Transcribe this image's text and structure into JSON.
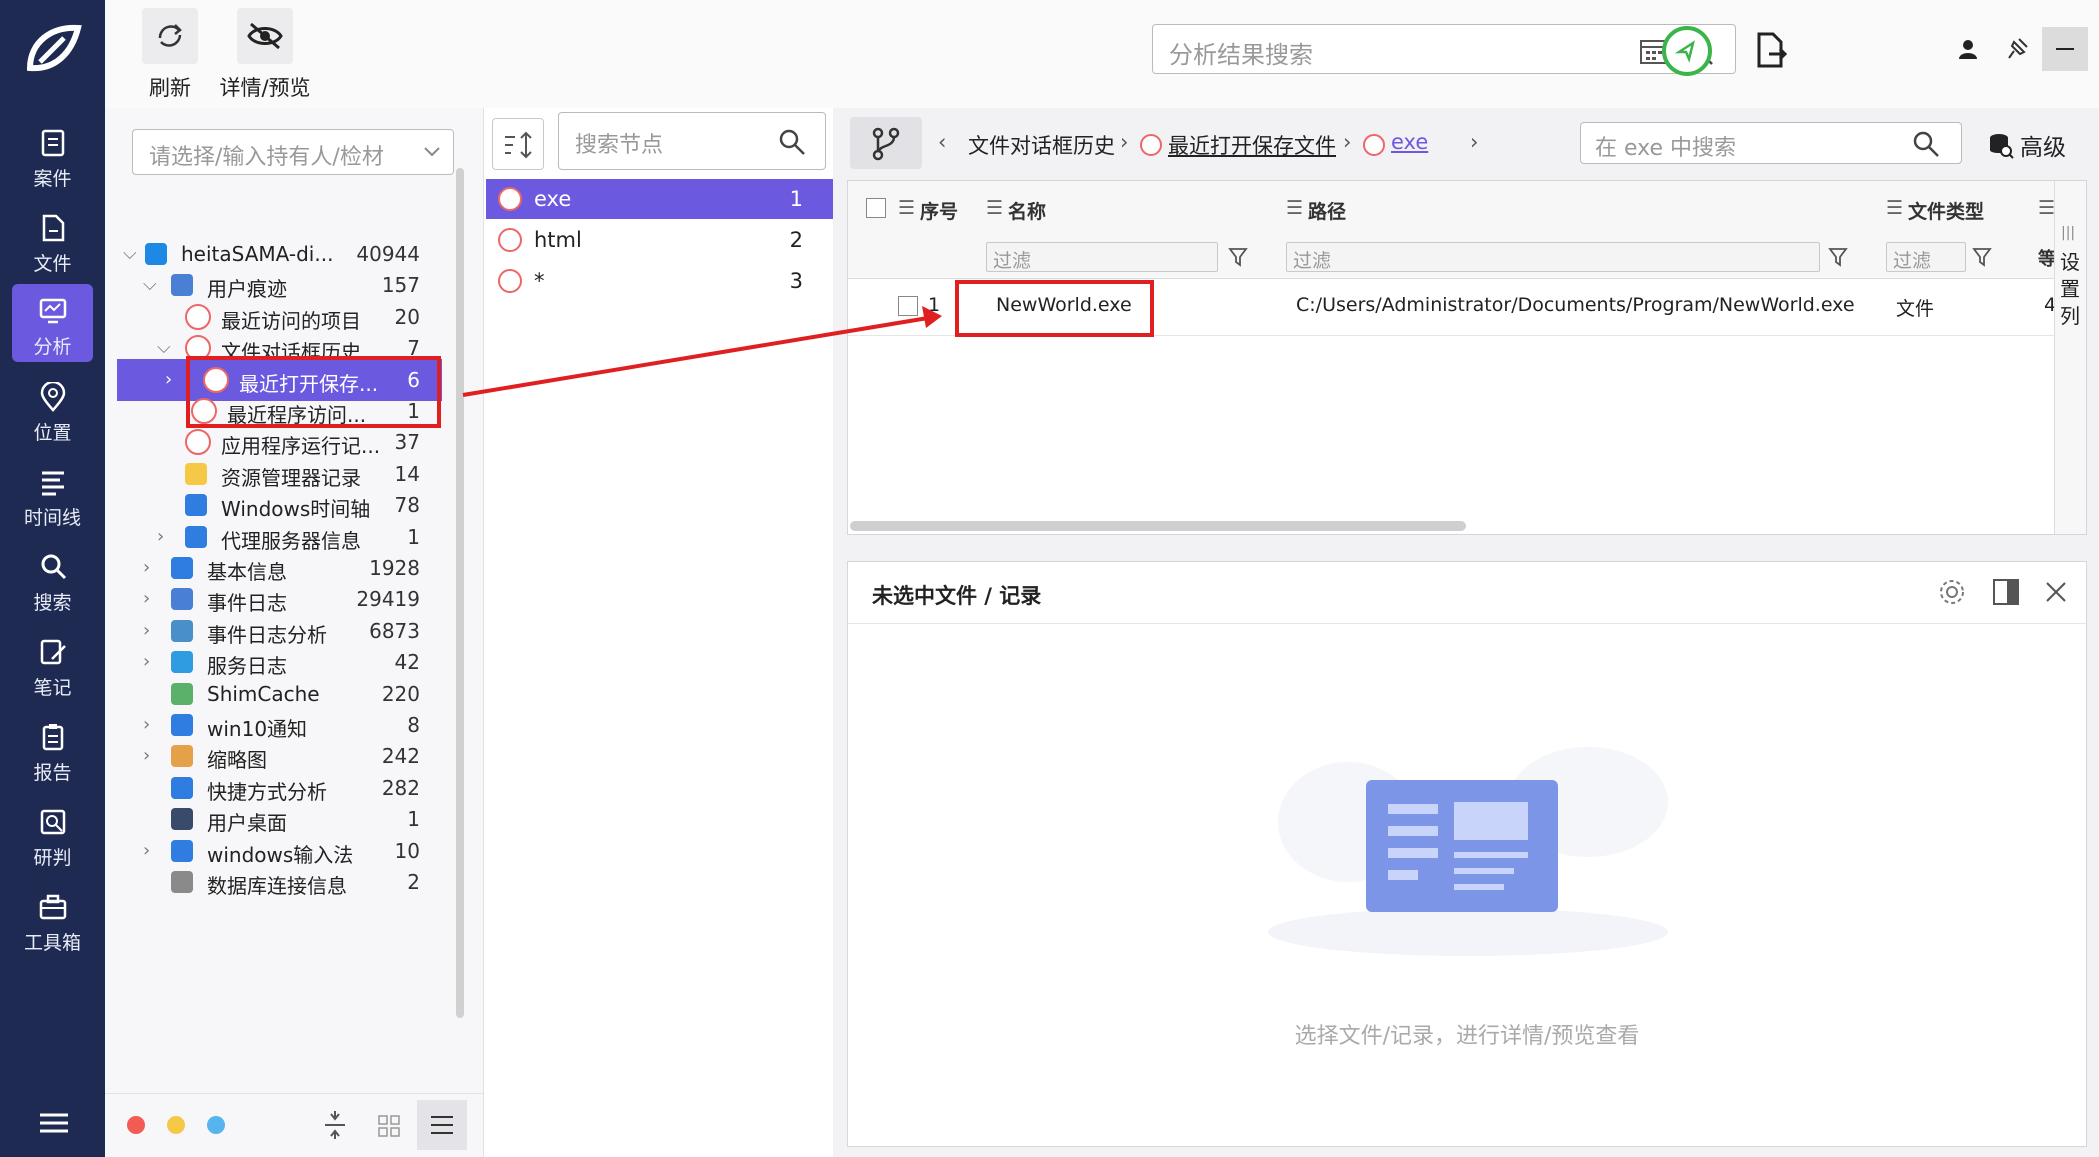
{
  "sidebar": {
    "items": [
      {
        "label": "案件",
        "icon": "case-icon"
      },
      {
        "label": "文件",
        "icon": "file-icon"
      },
      {
        "label": "分析",
        "icon": "analysis-icon"
      },
      {
        "label": "位置",
        "icon": "location-icon"
      },
      {
        "label": "时间线",
        "icon": "timeline-icon"
      },
      {
        "label": "搜索",
        "icon": "search-icon"
      },
      {
        "label": "笔记",
        "icon": "note-icon"
      },
      {
        "label": "报告",
        "icon": "report-icon"
      },
      {
        "label": "研判",
        "icon": "judge-icon"
      },
      {
        "label": "工具箱",
        "icon": "toolbox-icon"
      }
    ],
    "active_index": 2
  },
  "toolbar": {
    "refresh_label": "刷新",
    "preview_label": "详情/预览",
    "search_placeholder": "分析结果搜索"
  },
  "tree": {
    "owner_placeholder": "请选择/输入持有人/检材",
    "items": [
      {
        "label": "heitaSAMA-di...",
        "count": "40944",
        "level": 0,
        "expanded": true,
        "icon": "windows-icon"
      },
      {
        "label": "用户痕迹",
        "count": "157",
        "level": 1,
        "expanded": true,
        "icon": "user-trace-icon"
      },
      {
        "label": "最近访问的项目",
        "count": "20",
        "level": 2,
        "icon": "clock-icon"
      },
      {
        "label": "文件对话框历史",
        "count": "7",
        "level": 2,
        "expanded": true,
        "icon": "clock-icon"
      },
      {
        "label": "最近打开保存...",
        "count": "6",
        "level": 3,
        "selected": true,
        "icon": "clock-icon"
      },
      {
        "label": "最近程序访问...",
        "count": "1",
        "level": 3,
        "icon": "clock-icon"
      },
      {
        "label": "应用程序运行记...",
        "count": "37",
        "level": 2,
        "icon": "clock-icon"
      },
      {
        "label": "资源管理器记录",
        "count": "14",
        "level": 2,
        "icon": "folder-icon"
      },
      {
        "label": "Windows时间轴",
        "count": "78",
        "level": 2,
        "icon": "timeline-icon"
      },
      {
        "label": "代理服务器信息",
        "count": "1",
        "level": 2,
        "collapsed": true,
        "icon": "proxy-icon"
      },
      {
        "label": "基本信息",
        "count": "1928",
        "level": 1,
        "collapsed": true,
        "icon": "list-icon"
      },
      {
        "label": "事件日志",
        "count": "29419",
        "level": 1,
        "collapsed": true,
        "icon": "event-log-icon"
      },
      {
        "label": "事件日志分析",
        "count": "6873",
        "level": 1,
        "collapsed": true,
        "icon": "event-analysis-icon"
      },
      {
        "label": "服务日志",
        "count": "42",
        "level": 1,
        "collapsed": true,
        "icon": "service-icon"
      },
      {
        "label": "ShimCache",
        "count": "220",
        "level": 1,
        "icon": "shimcache-icon"
      },
      {
        "label": "win10通知",
        "count": "8",
        "level": 1,
        "collapsed": true,
        "icon": "bell-icon"
      },
      {
        "label": "缩略图",
        "count": "242",
        "level": 1,
        "collapsed": true,
        "icon": "thumbnail-icon"
      },
      {
        "label": "快捷方式分析",
        "count": "282",
        "level": 1,
        "icon": "shortcut-icon"
      },
      {
        "label": "用户桌面",
        "count": "1",
        "level": 1,
        "icon": "desktop-icon"
      },
      {
        "label": "windows输入法",
        "count": "10",
        "level": 1,
        "collapsed": true,
        "icon": "keyboard-icon"
      },
      {
        "label": "数据库连接信息",
        "count": "2",
        "level": 1,
        "icon": "database-icon"
      }
    ]
  },
  "nodes": {
    "search_placeholder": "搜索节点",
    "items": [
      {
        "label": "exe",
        "count": "1",
        "selected": true
      },
      {
        "label": "html",
        "count": "2"
      },
      {
        "label": "*",
        "count": "3"
      }
    ]
  },
  "breadcrumb": {
    "items": [
      "文件对话框历史",
      "最近打开保存文件",
      "exe"
    ],
    "search_placeholder": "在 exe 中搜索",
    "advanced_label": "高级"
  },
  "grid": {
    "columns": [
      "序号",
      "名称",
      "路径",
      "文件类型"
    ],
    "filter_placeholder": "过滤",
    "settings_label": "设置列",
    "rows": [
      {
        "index": "1",
        "name": "NewWorld.exe",
        "path": "C:/Users/Administrator/Documents/Program/NewWorld.exe",
        "type": "文件",
        "extra": "4"
      }
    ]
  },
  "detail": {
    "title": "未选中文件 / 记录",
    "empty_hint": "选择文件/记录，进行详情/预览查看"
  },
  "colors": {
    "sidebar_bg": "#1e2a52",
    "accent": "#6b5ae0",
    "highlight": "#e02020"
  }
}
